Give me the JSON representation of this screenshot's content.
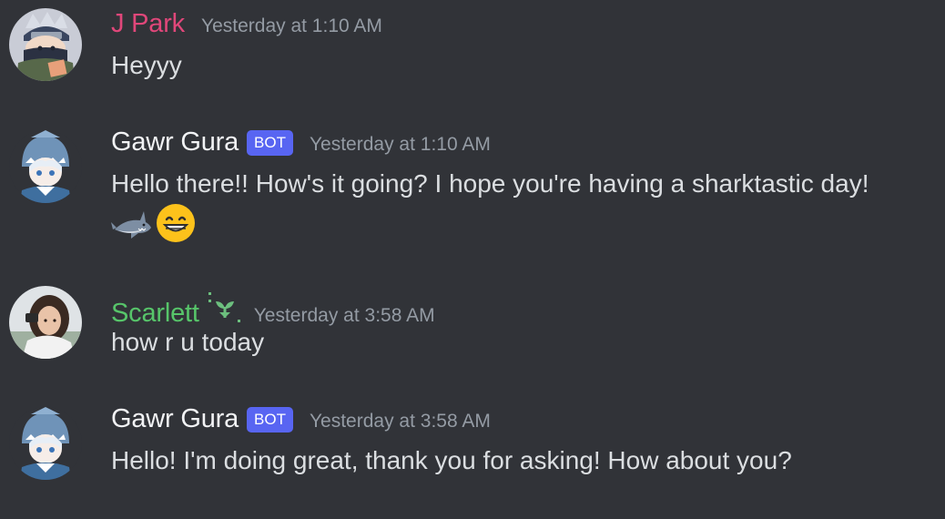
{
  "messages": [
    {
      "author": "J Park",
      "author_color": "#e0477a",
      "timestamp": "Yesterday at 1:10 AM",
      "text": "Heyyy",
      "avatar_icon": "ninja-avatar-icon"
    },
    {
      "author": "Gawr Gura",
      "author_color": "#f2f3f5",
      "badge": "BOT",
      "timestamp": "Yesterday at 1:10 AM",
      "text": "Hello there!! How's it going? I hope you're having a sharktastic day!",
      "emojis": [
        "shark-emoji-icon",
        "grinning-face-emoji-icon"
      ],
      "avatar_icon": "shark-girl-avatar-icon"
    },
    {
      "author": "Scarlett",
      "author_color": "#57c56a",
      "role_icon": "sprout-role-icon",
      "timestamp": "Yesterday at 3:58 AM",
      "text": "how r u today",
      "avatar_icon": "photo-avatar-icon"
    },
    {
      "author": "Gawr Gura",
      "author_color": "#f2f3f5",
      "badge": "BOT",
      "timestamp": "Yesterday at 3:58 AM",
      "text": "Hello! I'm doing great, thank you for asking! How about you?",
      "avatar_icon": "shark-girl-avatar-icon"
    }
  ],
  "colors": {
    "background": "#313338",
    "text": "#dbdee1",
    "timestamp": "#949ba4",
    "bot_badge": "#5865f2"
  }
}
